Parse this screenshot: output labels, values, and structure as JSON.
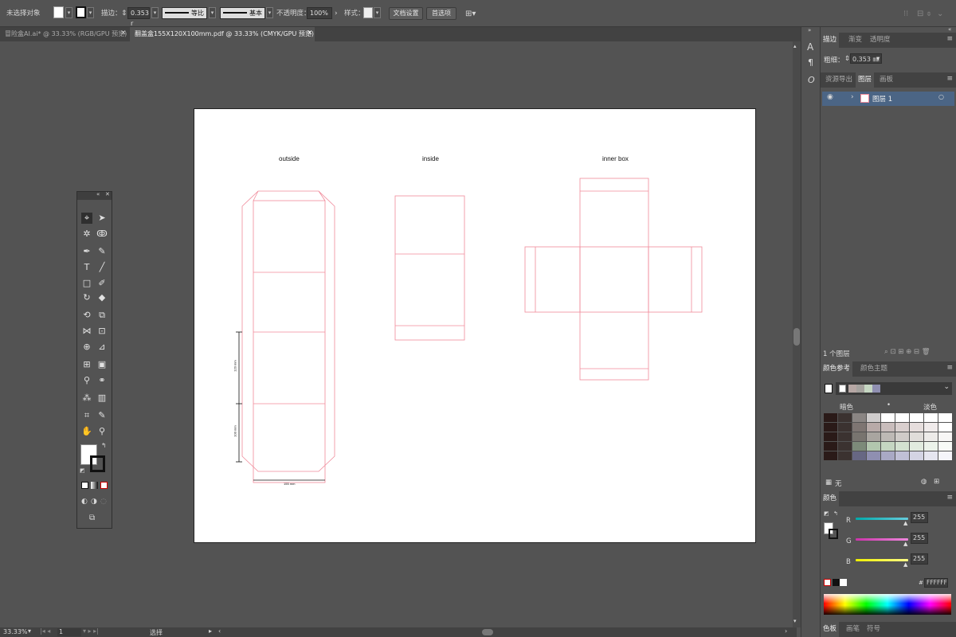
{
  "control_bar": {
    "selection": "未选择对象",
    "stroke_label": "描边：",
    "stroke_weight": "0.353 r",
    "profile": "等比",
    "brush": "基本",
    "opacity_label": "不透明度：",
    "opacity_value": "100%",
    "style_label": "样式：",
    "doc_setup": "文档设置",
    "preferences": "首选项"
  },
  "tabs": [
    {
      "label": "冒险盒AI.ai* @ 33.33% (RGB/GPU 预览)"
    },
    {
      "label": "翻盖盒155X120X100mm.pdf @ 33.33% (CMYK/GPU 预览)"
    }
  ],
  "artboard": {
    "labels": {
      "outside": "outside",
      "inside": "inside",
      "inner_box": "inner box"
    },
    "dims": {
      "h1": "120 mm",
      "h2": "100 mm",
      "w": "155 mm"
    },
    "line_color": "#f08a9a"
  },
  "statusbar": {
    "zoom": "33.33%",
    "page": "1",
    "tool": "选择"
  },
  "panels": {
    "stroke": {
      "tabs": [
        "描边",
        "渐变",
        "透明度"
      ],
      "weight_label": "粗细：",
      "weight_value": "0.353 ㎜"
    },
    "layers": {
      "tabs": [
        "资源导出",
        "图层",
        "画板"
      ],
      "layer_name": "图层 1",
      "count": "1 个图层"
    },
    "color_guide": {
      "tabs": [
        "颜色参考",
        "颜色主题"
      ],
      "dark_label": "暗色",
      "light_label": "淡色",
      "none_label": "无"
    },
    "color": {
      "title": "颜色",
      "channels": [
        {
          "name": "R",
          "value": "255"
        },
        {
          "name": "G",
          "value": "255"
        },
        {
          "name": "B",
          "value": "255"
        }
      ],
      "hex": "FFFFFF"
    },
    "bottom_tabs": [
      "色板",
      "画笔",
      "符号"
    ]
  },
  "colors": {
    "ui_bg": "#535353",
    "dark_bar": "#424242",
    "selection_row": "#4b6585",
    "accent": "#f08a9a"
  }
}
